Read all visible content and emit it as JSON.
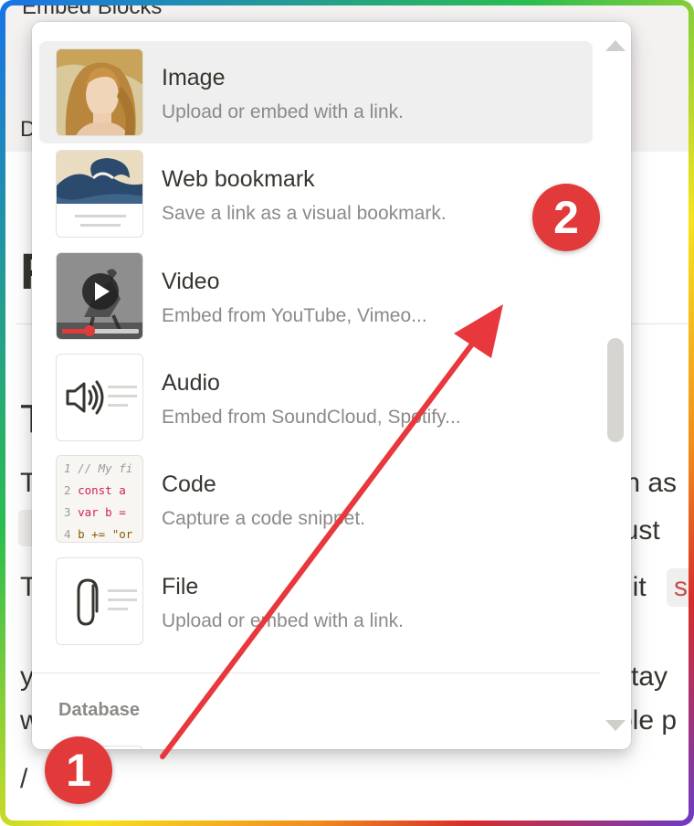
{
  "background": {
    "header_text": "Embed Blocks",
    "fragments": [
      "D",
      "F",
      "T",
      "T",
      "T",
      "y",
      "w",
      "/",
      "th as",
      "just",
      "hit",
      "s",
      "stay",
      "ple p"
    ]
  },
  "menu": {
    "items": [
      {
        "title": "Image",
        "subtitle": "Upload or embed with a link.",
        "thumb": "image-thumbnail"
      },
      {
        "title": "Web bookmark",
        "subtitle": "Save a link as a visual bookmark.",
        "thumb": "bookmark-thumbnail"
      },
      {
        "title": "Video",
        "subtitle": "Embed from YouTube, Vimeo...",
        "thumb": "video-thumbnail"
      },
      {
        "title": "Audio",
        "subtitle": "Embed from SoundCloud, Spotify...",
        "thumb": "speaker-icon"
      },
      {
        "title": "Code",
        "subtitle": "Capture a code snippet.",
        "thumb": "code-thumbnail"
      },
      {
        "title": "File",
        "subtitle": "Upload or embed with a link.",
        "thumb": "paperclip-icon"
      }
    ],
    "section_label": "Database",
    "code_sample": {
      "line_numbers": [
        "1",
        "2",
        "3",
        "4"
      ],
      "lines": [
        "// My fi",
        "const a",
        "var b =",
        "b += \"or"
      ]
    }
  },
  "annotations": {
    "badge_1": "1",
    "badge_2": "2",
    "arrow_color": "#e8383d"
  },
  "colors": {
    "accent_red": "#e23a3a",
    "selected_bg": "#efefef",
    "muted_text": "#8c8a87"
  }
}
